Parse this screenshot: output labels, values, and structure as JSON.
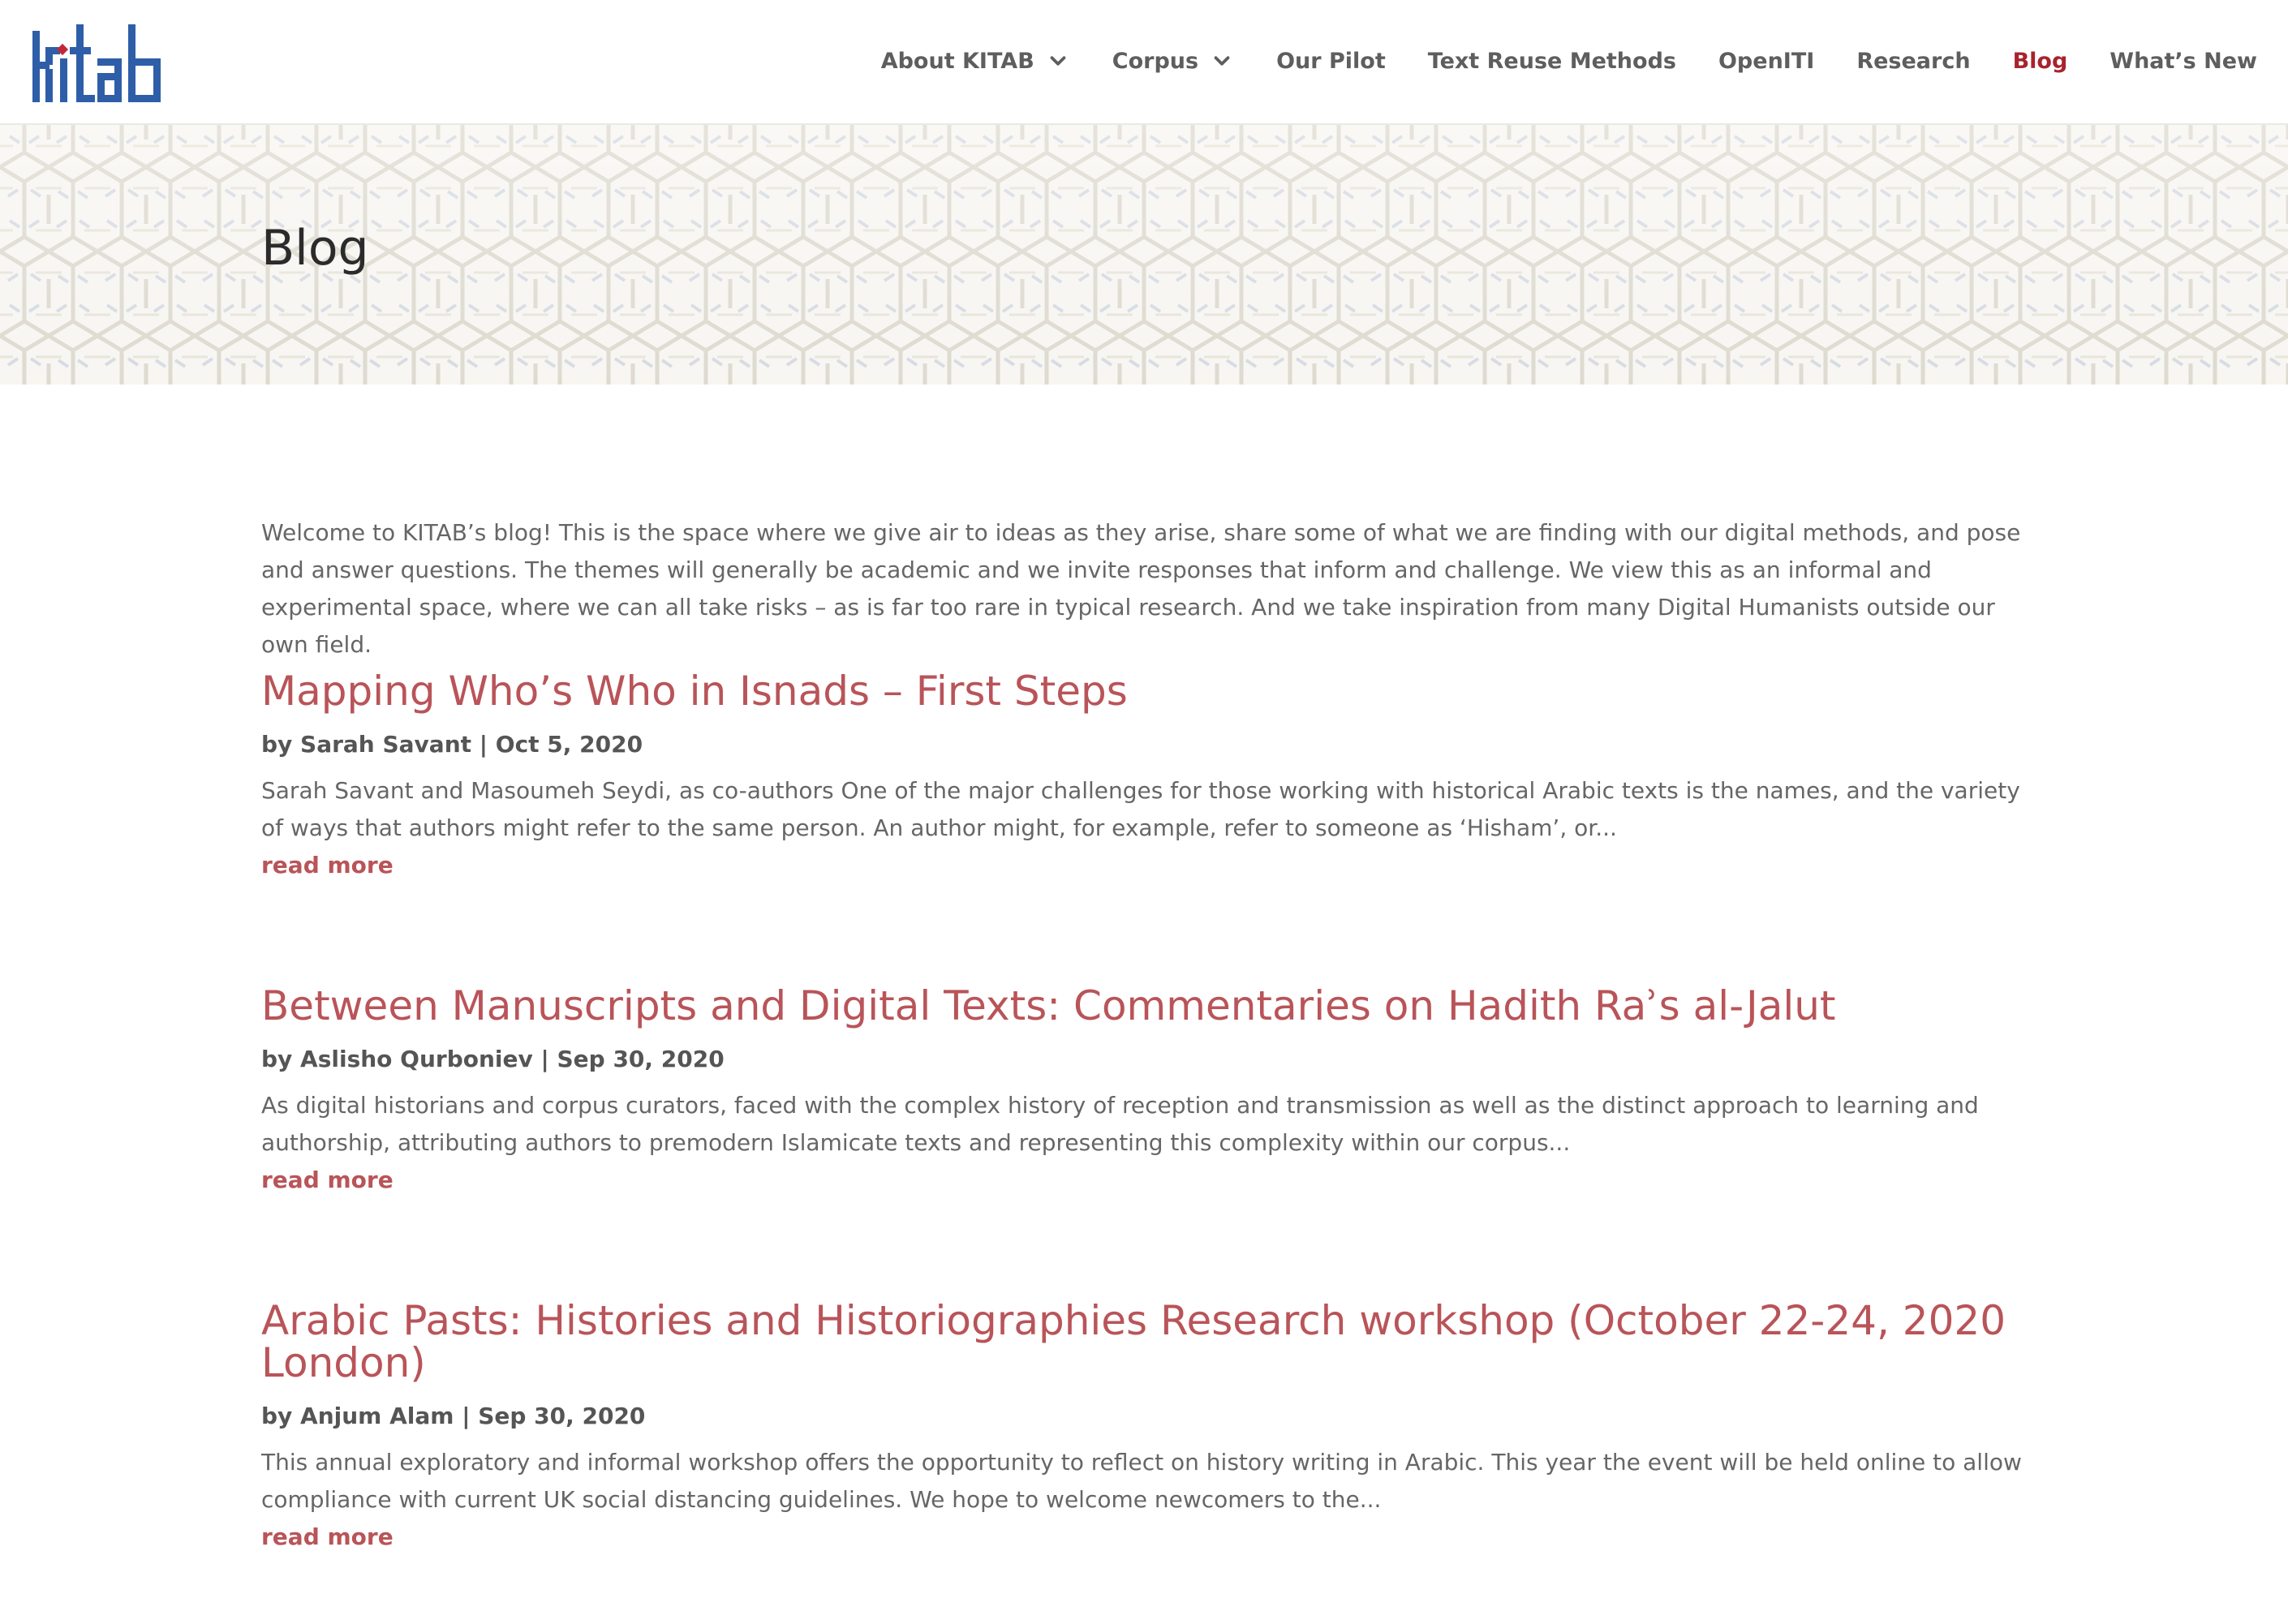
{
  "brand": {
    "logo_alt": "KITAB",
    "logo_color": "#2e5ea8",
    "logo_accent": "#c0283a"
  },
  "colors": {
    "accent": "#b95459",
    "nav_active": "#a8232c",
    "nav_text": "#5e5e5e"
  },
  "nav": {
    "items": [
      {
        "label": "About KITAB",
        "has_dropdown": true,
        "active": false
      },
      {
        "label": "Corpus",
        "has_dropdown": true,
        "active": false
      },
      {
        "label": "Our Pilot",
        "has_dropdown": false,
        "active": false
      },
      {
        "label": "Text Reuse Methods",
        "has_dropdown": false,
        "active": false
      },
      {
        "label": "OpenITI",
        "has_dropdown": false,
        "active": false
      },
      {
        "label": "Research",
        "has_dropdown": false,
        "active": false
      },
      {
        "label": "Blog",
        "has_dropdown": false,
        "active": true
      },
      {
        "label": "What’s New",
        "has_dropdown": false,
        "active": false
      }
    ]
  },
  "banner": {
    "title": "Blog"
  },
  "intro": "Welcome to KITAB’s blog! This is the space where we give air to ideas as they arise, share some of what we are finding with our digital methods, and pose and answer questions. The themes will generally be academic and we invite responses that inform and challenge. We view this as an informal and experimental space, where we can all take risks – as is far too rare in typical research. And we take inspiration from many Digital Humanists outside our own field.",
  "posts": [
    {
      "title": "Mapping Who’s Who in Isnads – First Steps",
      "by": "by",
      "author": "Sarah Savant",
      "separator": "|",
      "date": "Oct 5, 2020",
      "excerpt": "Sarah Savant and Masoumeh Seydi, as co-authors One of the major challenges for those working with historical Arabic texts is the names, and the variety of ways that authors might refer to the same person. An author might, for example, refer to someone as ‘Hisham’, or...",
      "read_more": "read more"
    },
    {
      "title": "Between Manuscripts and Digital Texts: Commentaries on Hadith Raʾs al-Jalut",
      "by": "by",
      "author": "Aslisho Qurboniev",
      "separator": "|",
      "date": "Sep 30, 2020",
      "excerpt": "As digital historians and corpus curators, faced with the complex history of reception and transmission as well as the distinct approach to learning and authorship, attributing authors to premodern Islamicate texts and representing this complexity within our corpus...",
      "read_more": "read more"
    },
    {
      "title": "Arabic Pasts: Histories and Historiographies Research workshop (October 22-24, 2020 London)",
      "by": "by",
      "author": "Anjum Alam",
      "separator": "|",
      "date": "Sep 30, 2020",
      "excerpt": "This annual exploratory and informal workshop offers the opportunity to reflect on history writing in Arabic. This year the event will be held online to allow compliance with current UK social distancing guidelines. We hope to welcome newcomers to the...",
      "read_more": "read more"
    }
  ]
}
